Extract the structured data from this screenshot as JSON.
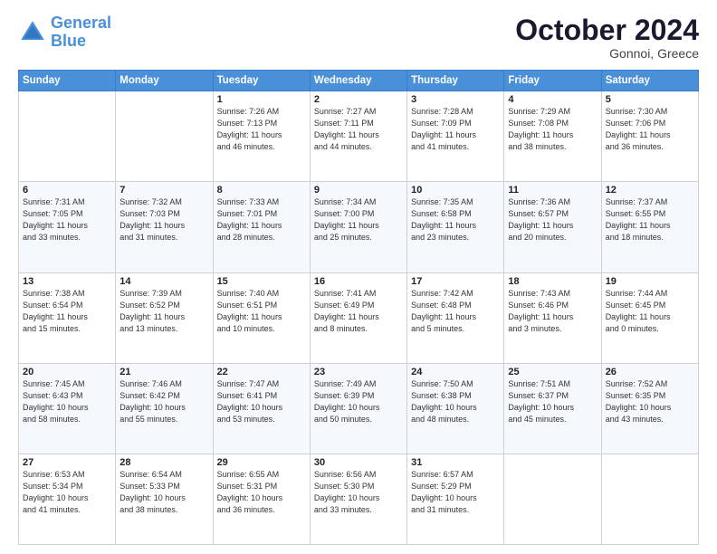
{
  "header": {
    "logo_general": "General",
    "logo_blue": "Blue",
    "month": "October 2024",
    "location": "Gonnoi, Greece"
  },
  "days_of_week": [
    "Sunday",
    "Monday",
    "Tuesday",
    "Wednesday",
    "Thursday",
    "Friday",
    "Saturday"
  ],
  "weeks": [
    [
      {
        "day": "",
        "info": ""
      },
      {
        "day": "",
        "info": ""
      },
      {
        "day": "1",
        "info": "Sunrise: 7:26 AM\nSunset: 7:13 PM\nDaylight: 11 hours\nand 46 minutes."
      },
      {
        "day": "2",
        "info": "Sunrise: 7:27 AM\nSunset: 7:11 PM\nDaylight: 11 hours\nand 44 minutes."
      },
      {
        "day": "3",
        "info": "Sunrise: 7:28 AM\nSunset: 7:09 PM\nDaylight: 11 hours\nand 41 minutes."
      },
      {
        "day": "4",
        "info": "Sunrise: 7:29 AM\nSunset: 7:08 PM\nDaylight: 11 hours\nand 38 minutes."
      },
      {
        "day": "5",
        "info": "Sunrise: 7:30 AM\nSunset: 7:06 PM\nDaylight: 11 hours\nand 36 minutes."
      }
    ],
    [
      {
        "day": "6",
        "info": "Sunrise: 7:31 AM\nSunset: 7:05 PM\nDaylight: 11 hours\nand 33 minutes."
      },
      {
        "day": "7",
        "info": "Sunrise: 7:32 AM\nSunset: 7:03 PM\nDaylight: 11 hours\nand 31 minutes."
      },
      {
        "day": "8",
        "info": "Sunrise: 7:33 AM\nSunset: 7:01 PM\nDaylight: 11 hours\nand 28 minutes."
      },
      {
        "day": "9",
        "info": "Sunrise: 7:34 AM\nSunset: 7:00 PM\nDaylight: 11 hours\nand 25 minutes."
      },
      {
        "day": "10",
        "info": "Sunrise: 7:35 AM\nSunset: 6:58 PM\nDaylight: 11 hours\nand 23 minutes."
      },
      {
        "day": "11",
        "info": "Sunrise: 7:36 AM\nSunset: 6:57 PM\nDaylight: 11 hours\nand 20 minutes."
      },
      {
        "day": "12",
        "info": "Sunrise: 7:37 AM\nSunset: 6:55 PM\nDaylight: 11 hours\nand 18 minutes."
      }
    ],
    [
      {
        "day": "13",
        "info": "Sunrise: 7:38 AM\nSunset: 6:54 PM\nDaylight: 11 hours\nand 15 minutes."
      },
      {
        "day": "14",
        "info": "Sunrise: 7:39 AM\nSunset: 6:52 PM\nDaylight: 11 hours\nand 13 minutes."
      },
      {
        "day": "15",
        "info": "Sunrise: 7:40 AM\nSunset: 6:51 PM\nDaylight: 11 hours\nand 10 minutes."
      },
      {
        "day": "16",
        "info": "Sunrise: 7:41 AM\nSunset: 6:49 PM\nDaylight: 11 hours\nand 8 minutes."
      },
      {
        "day": "17",
        "info": "Sunrise: 7:42 AM\nSunset: 6:48 PM\nDaylight: 11 hours\nand 5 minutes."
      },
      {
        "day": "18",
        "info": "Sunrise: 7:43 AM\nSunset: 6:46 PM\nDaylight: 11 hours\nand 3 minutes."
      },
      {
        "day": "19",
        "info": "Sunrise: 7:44 AM\nSunset: 6:45 PM\nDaylight: 11 hours\nand 0 minutes."
      }
    ],
    [
      {
        "day": "20",
        "info": "Sunrise: 7:45 AM\nSunset: 6:43 PM\nDaylight: 10 hours\nand 58 minutes."
      },
      {
        "day": "21",
        "info": "Sunrise: 7:46 AM\nSunset: 6:42 PM\nDaylight: 10 hours\nand 55 minutes."
      },
      {
        "day": "22",
        "info": "Sunrise: 7:47 AM\nSunset: 6:41 PM\nDaylight: 10 hours\nand 53 minutes."
      },
      {
        "day": "23",
        "info": "Sunrise: 7:49 AM\nSunset: 6:39 PM\nDaylight: 10 hours\nand 50 minutes."
      },
      {
        "day": "24",
        "info": "Sunrise: 7:50 AM\nSunset: 6:38 PM\nDaylight: 10 hours\nand 48 minutes."
      },
      {
        "day": "25",
        "info": "Sunrise: 7:51 AM\nSunset: 6:37 PM\nDaylight: 10 hours\nand 45 minutes."
      },
      {
        "day": "26",
        "info": "Sunrise: 7:52 AM\nSunset: 6:35 PM\nDaylight: 10 hours\nand 43 minutes."
      }
    ],
    [
      {
        "day": "27",
        "info": "Sunrise: 6:53 AM\nSunset: 5:34 PM\nDaylight: 10 hours\nand 41 minutes."
      },
      {
        "day": "28",
        "info": "Sunrise: 6:54 AM\nSunset: 5:33 PM\nDaylight: 10 hours\nand 38 minutes."
      },
      {
        "day": "29",
        "info": "Sunrise: 6:55 AM\nSunset: 5:31 PM\nDaylight: 10 hours\nand 36 minutes."
      },
      {
        "day": "30",
        "info": "Sunrise: 6:56 AM\nSunset: 5:30 PM\nDaylight: 10 hours\nand 33 minutes."
      },
      {
        "day": "31",
        "info": "Sunrise: 6:57 AM\nSunset: 5:29 PM\nDaylight: 10 hours\nand 31 minutes."
      },
      {
        "day": "",
        "info": ""
      },
      {
        "day": "",
        "info": ""
      }
    ]
  ]
}
